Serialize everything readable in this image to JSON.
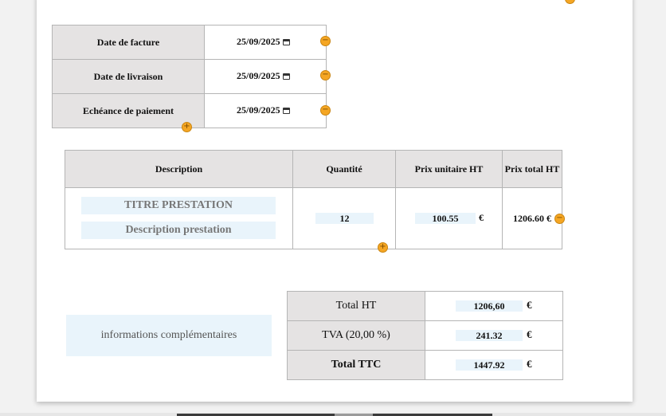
{
  "dates": {
    "invoice_label": "Date de facture",
    "invoice_value": "25/09/2025",
    "delivery_label": "Date de livraison",
    "delivery_value": "25/09/2025",
    "due_label": "Echéance de paiement",
    "due_value": "25/09/2025"
  },
  "items": {
    "headers": {
      "description": "Description",
      "quantity": "Quantité",
      "unit_price": "Prix unitaire HT",
      "total_price": "Prix total HT"
    },
    "rows": [
      {
        "title": "TITRE PRESTATION",
        "description": "Description prestation",
        "quantity": "12",
        "unit_price": "100.55",
        "currency": "€",
        "total": "1206.60 €"
      }
    ]
  },
  "notes": {
    "text": "informations complémentaires"
  },
  "totals": {
    "ht_label": "Total HT",
    "ht_value": "1206,60",
    "tva_label": "TVA (20,00 %)",
    "tva_value": "241.32",
    "ttc_label": "Total TTC",
    "ttc_value": "1447.92",
    "currency": "€"
  },
  "icons": {
    "remove": "−",
    "add": "+"
  },
  "colors": {
    "accent_orange": "#f5a623",
    "header_gray": "#e5e3e3",
    "input_blue": "#e9f4fb"
  }
}
